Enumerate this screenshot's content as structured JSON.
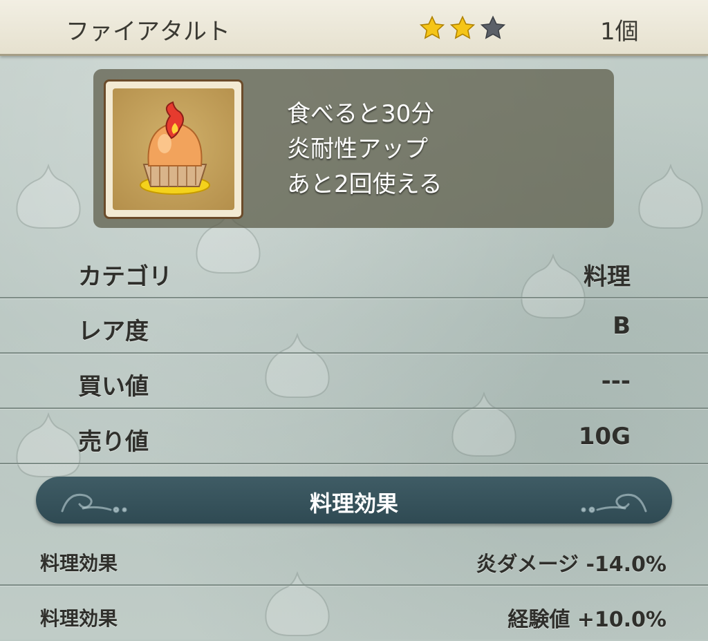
{
  "header": {
    "item_name": "ファイアタルト",
    "rating": {
      "filled": 2,
      "total": 3
    },
    "quantity": "1個"
  },
  "item_icon": "fire-tart-icon",
  "description": {
    "line1": "食べると30分",
    "line2": "炎耐性アップ",
    "line3": "あと2回使える"
  },
  "stats": [
    {
      "label": "カテゴリ",
      "value": "料理"
    },
    {
      "label": "レア度",
      "value": "B"
    },
    {
      "label": "買い値",
      "value": "---"
    },
    {
      "label": "売り値",
      "value": "10G"
    }
  ],
  "section": {
    "title": "料理効果"
  },
  "effects": [
    {
      "label": "料理効果",
      "value": "炎ダメージ -14.0%"
    },
    {
      "label": "料理効果",
      "value": "経験値 +10.0%"
    }
  ],
  "colors": {
    "star_filled": "#f5c518",
    "star_empty": "#5b6068",
    "section_bar": "#2f4a53"
  }
}
